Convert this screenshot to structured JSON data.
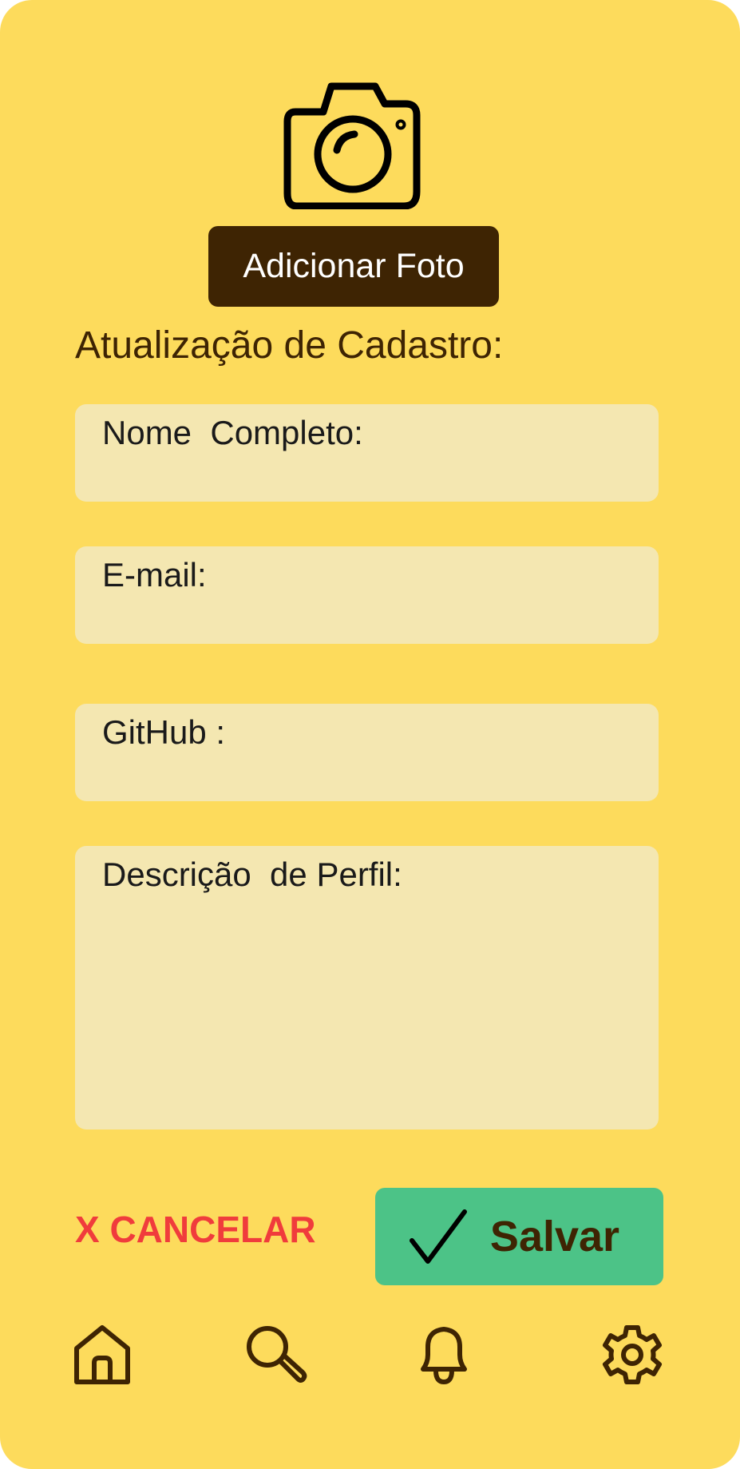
{
  "profile_photo": {
    "icon": "camera-icon",
    "add_photo_label": "Adicionar Foto"
  },
  "form": {
    "title": "Atualização de Cadastro:",
    "fields": [
      {
        "label": "Nome  Completo:",
        "value": ""
      },
      {
        "label": "E-mail:",
        "value": ""
      },
      {
        "label": "GitHub :",
        "value": ""
      },
      {
        "label": "Descrição  de Perfil:",
        "value": ""
      }
    ]
  },
  "actions": {
    "cancel_label": "X CANCELAR",
    "save_label": "Salvar"
  },
  "bottom_nav": {
    "items": [
      {
        "icon": "home-icon"
      },
      {
        "icon": "search-icon"
      },
      {
        "icon": "bell-icon"
      },
      {
        "icon": "gear-icon"
      }
    ]
  },
  "colors": {
    "background": "#FDDB5C",
    "field_bg": "#F4E7B1",
    "primary_dark": "#3E2403",
    "cancel_red": "#F03C3C",
    "save_green": "#4CC387"
  }
}
